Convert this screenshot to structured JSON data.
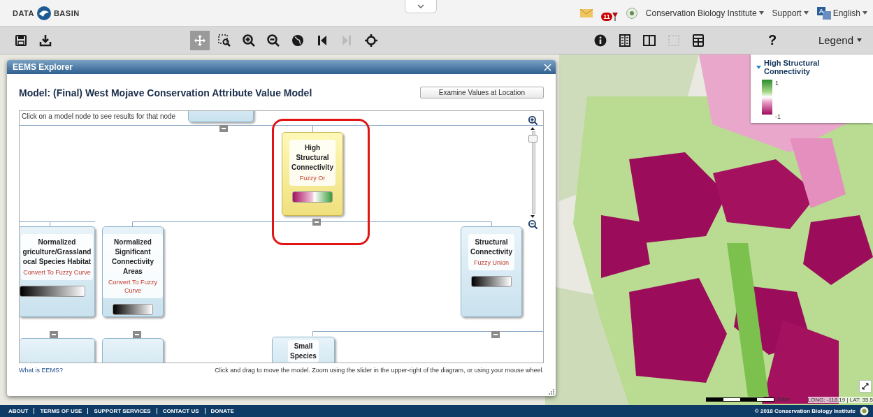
{
  "header": {
    "logo_left": "DATA",
    "logo_right": "BASIN",
    "notifications": "11",
    "account": "Conservation Biology Institute",
    "support": "Support",
    "language": "English"
  },
  "toolbar": {
    "left_tools": [
      {
        "kind": "save",
        "selected": false,
        "disabled": false
      },
      {
        "kind": "download",
        "selected": false,
        "disabled": false
      }
    ],
    "center_tools": [
      {
        "kind": "pan",
        "selected": true,
        "disabled": false
      },
      {
        "kind": "zoom-box",
        "selected": false,
        "disabled": false
      },
      {
        "kind": "zoom-in",
        "selected": false,
        "disabled": false
      },
      {
        "kind": "zoom-out",
        "selected": false,
        "disabled": false
      },
      {
        "kind": "globe",
        "selected": false,
        "disabled": false
      },
      {
        "kind": "back",
        "selected": false,
        "disabled": false
      },
      {
        "kind": "forward",
        "selected": false,
        "disabled": true
      },
      {
        "kind": "locate",
        "selected": false,
        "disabled": false
      }
    ],
    "right_tools": [
      {
        "kind": "info",
        "selected": false,
        "disabled": false
      },
      {
        "kind": "attributes",
        "selected": false,
        "disabled": false
      },
      {
        "kind": "split",
        "selected": false,
        "disabled": false
      },
      {
        "kind": "select",
        "selected": false,
        "disabled": true
      },
      {
        "kind": "calculator",
        "selected": false,
        "disabled": false
      }
    ],
    "help": "?",
    "legend": "Legend"
  },
  "dialog": {
    "title": "EEMS Explorer",
    "heading": "Model: (Final) West Mojave Conservation Attribute Value Model",
    "button": "Examine Values at Location",
    "hint": "Click on a model node to see results for that node",
    "zoom": {
      "level": 0.95
    },
    "nodes": [
      {
        "lines": [
          "High",
          "Structural",
          "Connectivity"
        ],
        "operation": "Fuzzy Or",
        "kind": "diverging",
        "selected": true,
        "highlighted": true
      },
      {
        "lines": [
          "Normalized",
          "griculture/Grassland",
          "ocal Species Habitat"
        ],
        "operation": "Convert To Fuzzy Curve",
        "kind": "grey",
        "selected": false,
        "highlighted": false
      },
      {
        "lines": [
          "Normalized",
          "Significant",
          "Connectivity",
          "Areas"
        ],
        "operation": "Convert To Fuzzy Curve",
        "kind": "grey",
        "selected": false,
        "highlighted": false
      },
      {
        "lines": [
          "Structural",
          "Connectivity"
        ],
        "operation": "Fuzzy Union",
        "kind": "grey",
        "selected": false,
        "highlighted": false
      },
      {
        "lines": [
          "Small",
          "Species"
        ],
        "kind": "plain",
        "selected": false,
        "highlighted": false
      }
    ],
    "link": "What is EEMS?",
    "instructions": "Click and drag to move the model. Zoom using the slider in the upper-right of the diagram, or using your mouse wheel."
  },
  "legend": {
    "title": "High Structural Connectivity",
    "max": "1",
    "min": "-1"
  },
  "map": {
    "scale": "30km",
    "coordinates": "LONG: -118.19 | LAT: 35.5"
  },
  "footer": {
    "links": [
      "ABOUT",
      "TERMS OF USE",
      "SUPPORT SERVICES",
      "CONTACT US",
      "DONATE"
    ],
    "copyright": "© 2018 Conservation Biology Institute"
  }
}
